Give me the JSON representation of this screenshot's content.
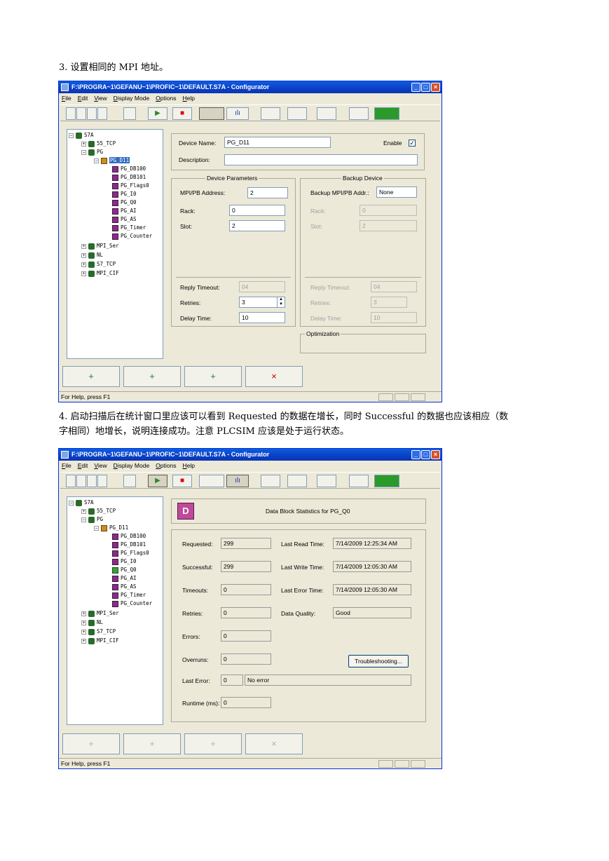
{
  "paragraphs": {
    "p3": "3. 设置相同的 MPI 地址。",
    "p4_line1": "4. 启动扫描后在统计窗口里应该可以看到 Requested 的数据在增长，同时 Successful 的数据也应该相应（数",
    "p4_line2": "字相同）地增长，说明连接成功。注意 PLCSIM 应该是处于运行状态。"
  },
  "window": {
    "title": "F:\\PROGRA~1\\GEFANU~1\\PROFIC~1\\DEFAULT.S7A - Configurator",
    "menu": [
      "File",
      "Edit",
      "View",
      "Display Mode",
      "Options",
      "Help"
    ],
    "status_text": "For Help, press F1",
    "titlebar_buttons": [
      "_",
      "□",
      "×"
    ]
  },
  "toolbar": {
    "run": "▶",
    "stop": "■",
    "stats": "ılı"
  },
  "tree": {
    "root": "S7A",
    "items1": [
      "55_TCP",
      "PG",
      "PG_D11",
      "PG_DB100",
      "PG_DB101",
      "PG_Flags0",
      "PG_I0",
      "PG_Q0",
      "PG_AI",
      "PG_AS",
      "PG_Timer",
      "PG_Counter",
      "MPI_Ser",
      "NL",
      "S7_TCP",
      "MPI_CIF"
    ],
    "plus": "+",
    "minus": "−"
  },
  "config": {
    "device_name_label": "Device Name:",
    "device_name": "PG_D11",
    "enable_label": "Enable",
    "enable_check": "✓",
    "description_label": "Description:",
    "description": "",
    "device_params_title": "Device Parameters",
    "backup_title": "Backup Device",
    "mpi_label": "MPI/PB Address:",
    "mpi": "2",
    "backup_mpi_label": "Backup MPI/PB Addr.:",
    "backup_mpi": "None",
    "rack_label": "Rack:",
    "rack": "0",
    "slot_label": "Slot:",
    "slot": "2",
    "b_rack_label": "Rack:",
    "b_rack": "0",
    "b_slot_label": "Slot:",
    "b_slot": "2",
    "reply_timeout_label": "Reply Timeout:",
    "reply_timeout": "04",
    "retries_label": "Retries:",
    "retries": "3",
    "delay_label": "Delay Time:",
    "delay": "10",
    "b_reply_timeout_label": "Reply Timeout:",
    "b_reply_timeout": "04",
    "b_retries_label": "Retries:",
    "b_retries": "3",
    "b_delay_label": "Delay Time:",
    "b_delay": "10",
    "optimization_title": "Optimization"
  },
  "stats": {
    "header": "Data Block Statistics for PG_Q0",
    "icon": "D",
    "requested_label": "Requested:",
    "requested": "299",
    "successful_label": "Successful:",
    "successful": "299",
    "timeouts_label": "Timeouts:",
    "timeouts": "0",
    "retries_label": "Retries:",
    "retries": "0",
    "errors_label": "Errors:",
    "errors": "0",
    "overruns_label": "Overruns:",
    "overruns": "0",
    "last_error_label": "Last Error:",
    "last_error_code": "0",
    "last_error_text": "No error",
    "runtime_label": "Runtime (ms):",
    "runtime": "0",
    "last_read_label": "Last Read Time:",
    "last_read": "7/14/2009 12:25:34 AM",
    "last_write_label": "Last Write Time:",
    "last_write": "7/14/2009 12:05:30 AM",
    "last_error_time_label": "Last Error Time:",
    "last_error_time": "7/14/2009 12:05:30 AM",
    "quality_label": "Data Quality:",
    "quality": "Good",
    "troubleshoot": "Troubleshooting..."
  },
  "bottom": {
    "add_channel": "+",
    "add_device": "+",
    "add_block": "+",
    "delete": "×"
  }
}
